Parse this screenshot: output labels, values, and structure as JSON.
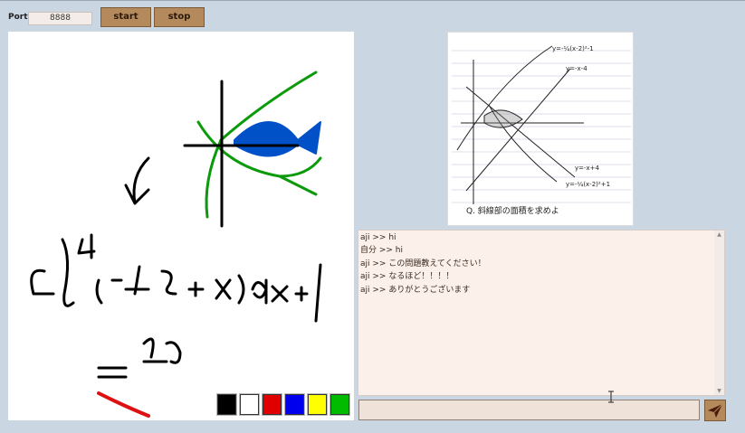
{
  "toolbar": {
    "port_label": "Port",
    "port_value": "8888",
    "start_label": "start",
    "stop_label": "stop"
  },
  "palette": {
    "colors": [
      "#000000",
      "#ffffff",
      "#e00000",
      "#0000ee",
      "#ffff00",
      "#00bb00"
    ],
    "selected_index": 2
  },
  "canvas": {
    "drawing_strokes_colors": [
      "#000000",
      "#0a9a0a",
      "#0050c8",
      "#dd1111"
    ]
  },
  "problem": {
    "curve_labels": {
      "top_parabola": "y=-¼(x-2)²-1",
      "line_top": "y=-x-4",
      "line_bottom": "y=-x+4",
      "bottom_parabola": "y=-¼(x-2)²+1"
    },
    "question": "Q. 斜線部の面積を求めよ"
  },
  "chat": {
    "messages": [
      "aji >> hi",
      "自分 >> hi",
      "aji >> この問題教えてください！",
      "aji >> なるほど！！！！",
      "aji >> ありがとうございます"
    ],
    "input_value": ""
  }
}
